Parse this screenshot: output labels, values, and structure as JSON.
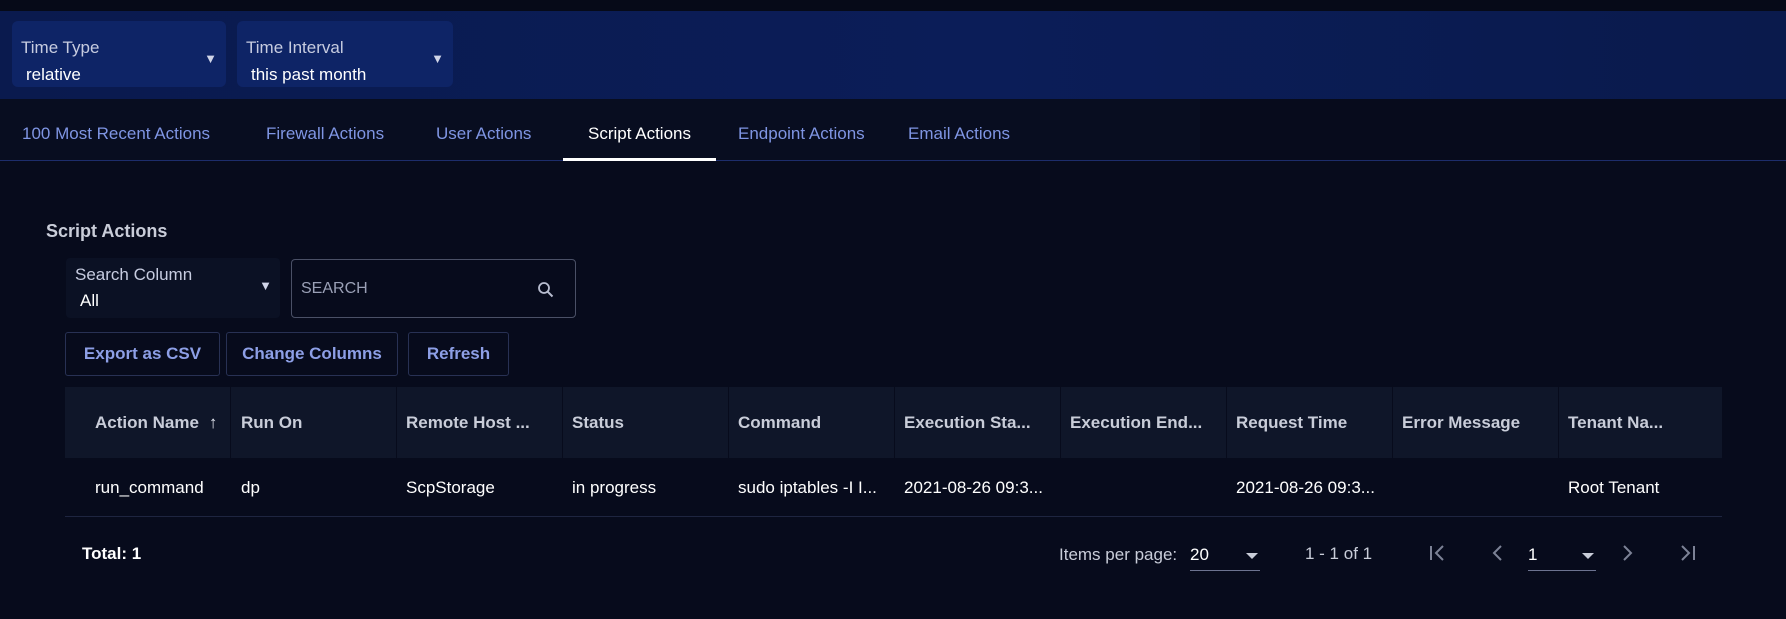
{
  "filters": {
    "time_type": {
      "label": "Time Type",
      "value": "relative"
    },
    "time_interval": {
      "label": "Time Interval",
      "value": "this past month"
    }
  },
  "tabs": [
    {
      "label": "100 Most Recent Actions",
      "active": false
    },
    {
      "label": "Firewall Actions",
      "active": false
    },
    {
      "label": "User Actions",
      "active": false
    },
    {
      "label": "Script Actions",
      "active": true
    },
    {
      "label": "Endpoint Actions",
      "active": false
    },
    {
      "label": "Email Actions",
      "active": false
    }
  ],
  "section": {
    "title": "Script Actions",
    "search_column": {
      "label": "Search Column",
      "value": "All"
    },
    "search": {
      "placeholder": "SEARCH",
      "value": ""
    },
    "buttons": {
      "export": "Export as CSV",
      "change_columns": "Change Columns",
      "refresh": "Refresh"
    }
  },
  "table": {
    "columns": [
      "Action Name",
      "Run On",
      "Remote Host ...",
      "Status",
      "Command",
      "Execution Sta...",
      "Execution End...",
      "Request Time",
      "Error Message",
      "Tenant Na..."
    ],
    "sort_indicator": "↑",
    "rows": [
      [
        "run_command",
        "dp",
        "ScpStorage",
        "in progress",
        "sudo iptables -I I...",
        "2021-08-26 09:3...",
        "",
        "2021-08-26 09:3...",
        "",
        "Root Tenant"
      ]
    ]
  },
  "pagination": {
    "total": "Total: 1",
    "items_per_page_label": "Items per page:",
    "items_per_page": "20",
    "range": "1 - 1 of 1",
    "page": "1"
  },
  "colors": {
    "filter_bar": "#0b1d58",
    "background": "#070b1c",
    "accent": "#8d9fe6",
    "tab_link": "#7f95e3"
  }
}
